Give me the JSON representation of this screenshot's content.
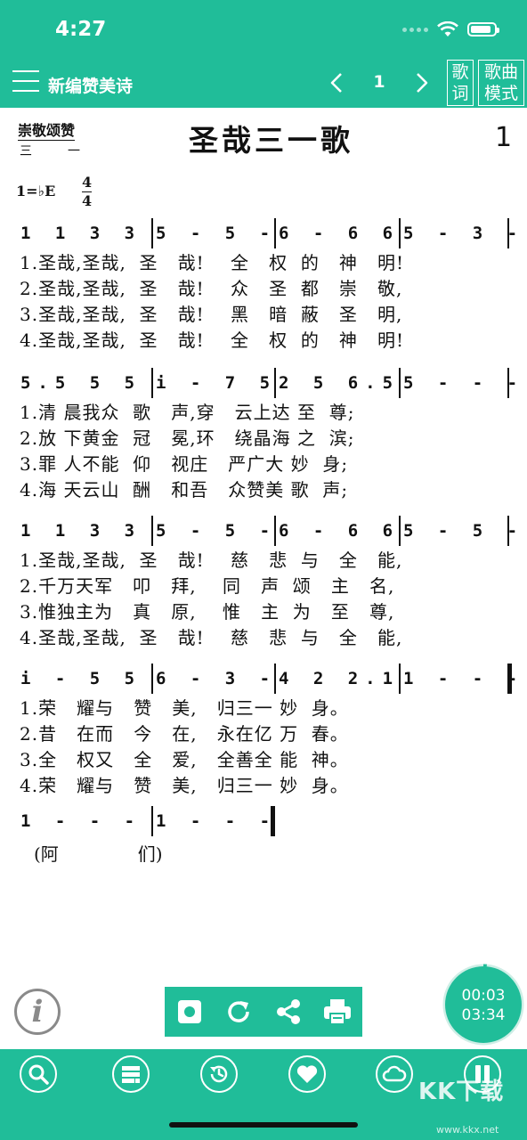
{
  "status": {
    "time": "4:27"
  },
  "header": {
    "app_title": "新编赞美诗",
    "page_number": "1",
    "lyrics_button": "歌\n词",
    "mode_button": "歌曲\n模式"
  },
  "sheet": {
    "category": "崇敬颂赞",
    "category_sub": "三一",
    "title": "圣哉三一歌",
    "number": "1",
    "key": "1=♭E",
    "time_sig_top": "4",
    "time_sig_bottom": "4",
    "systems": [
      {
        "measures": [
          "1 1 3 3",
          "5 - 5 -",
          "6 - 6 6",
          "5 - 3 -"
        ],
        "lyrics": [
          "1.圣哉,圣哉,  圣   哉!    全   权  的   神   明!",
          "2.圣哉,圣哉,  圣   哉!    众   圣  都   崇   敬,",
          "3.圣哉,圣哉,  圣   哉!    黑   暗  蔽   圣   明,",
          "4.圣哉,圣哉,  圣   哉!    全   权  的   神   明!"
        ]
      },
      {
        "measures": [
          "5.5 5 5",
          "i - 7 5",
          "2 5 6.5",
          "5 - - -"
        ],
        "lyrics": [
          "1.清 晨我众  歌   声,穿   云上达 至  尊;",
          "2.放 下黄金  冠   冕,环   绕晶海 之  滨;",
          "3.罪 人不能  仰   视庄   严广大 妙  身;",
          "4.海 天云山  酬   和吾   众赞美 歌  声;"
        ]
      },
      {
        "measures": [
          "1 1 3 3",
          "5 - 5 -",
          "6 - 6 6",
          "5 - 5 -"
        ],
        "lyrics": [
          "1.圣哉,圣哉,  圣   哉!    慈   悲  与   全   能,",
          "2.千万天军   叩   拜,    同   声  颂   主   名,",
          "3.惟独主为   真   原,    惟   主  为   至   尊,",
          "4.圣哉,圣哉,  圣   哉!    慈   悲  与   全   能,"
        ]
      },
      {
        "measures": [
          "i - 5 5",
          "6 - 3 -",
          "4 2 2.1",
          "1 - - -"
        ],
        "lyrics": [
          "1.荣   耀与   赞   美,   归三一 妙  身。",
          "2.昔   在而   今   在,   永在亿 万  春。",
          "3.全   权又   全   爱,   全善全 能  神。",
          "4.荣   耀与   赞   美,   归三一 妙  身。"
        ]
      }
    ],
    "amen_measures": [
      "1 - - -",
      "1 - - -"
    ],
    "amen_lyric": "(阿              们)"
  },
  "player": {
    "elapsed": "00:03",
    "total": "03:34",
    "progress": 0.014
  },
  "colors": {
    "accent": "#20bd99"
  },
  "icons": {
    "toolbar": [
      "record-icon",
      "replay-icon",
      "share-icon",
      "print-icon"
    ],
    "bottom_nav": [
      "search-icon",
      "list-icon",
      "history-icon",
      "favorite-icon",
      "cloud-icon",
      "pause-icon"
    ]
  },
  "watermark": {
    "text": "KK下载",
    "sub": "www.kkx.net"
  }
}
